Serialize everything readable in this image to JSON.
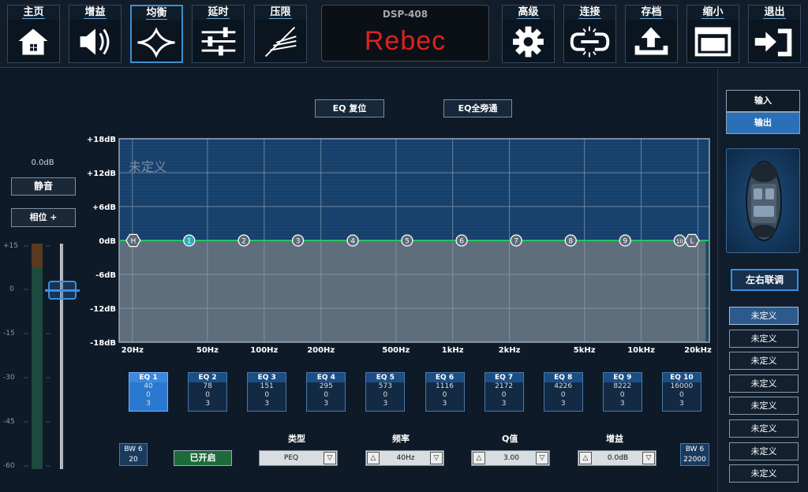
{
  "nav": {
    "left": [
      {
        "label": "主页",
        "icon": "home-icon"
      },
      {
        "label": "增益",
        "icon": "speaker-icon"
      },
      {
        "label": "均衡",
        "icon": "eq-star-icon"
      },
      {
        "label": "延时",
        "icon": "sliders-icon"
      },
      {
        "label": "压限",
        "icon": "limiter-icon"
      }
    ],
    "right": [
      {
        "label": "高级",
        "icon": "gear-icon"
      },
      {
        "label": "连接",
        "icon": "link-icon"
      },
      {
        "label": "存档",
        "icon": "upload-icon"
      },
      {
        "label": "缩小",
        "icon": "window-icon"
      },
      {
        "label": "退出",
        "icon": "exit-icon"
      }
    ],
    "active_index": 2
  },
  "logo": {
    "model": "DSP-408",
    "brand": "Rebec"
  },
  "eq_actions": {
    "reset": "EQ 复位",
    "bypass": "EQ全旁通"
  },
  "left_panel": {
    "level": "0.0dB",
    "mute": "静音",
    "phase": "相位 +",
    "scale": [
      "+15",
      "0",
      "-15",
      "-30",
      "-45",
      "-60"
    ],
    "fader_value_db": 0
  },
  "chart": {
    "watermark": "未定义",
    "y_labels": [
      "+18dB",
      "+12dB",
      "+6dB",
      "0dB",
      "-6dB",
      "-12dB",
      "-18dB"
    ],
    "x_labels": [
      "20Hz",
      "50Hz",
      "100Hz",
      "200Hz",
      "500Hz",
      "1kHz",
      "2kHz",
      "5kHz",
      "10kHz",
      "20kHz"
    ],
    "markers": [
      "H",
      "1",
      "2",
      "3",
      "4",
      "5",
      "6",
      "7",
      "8",
      "9",
      "10",
      "L"
    ]
  },
  "chart_data": {
    "type": "line",
    "ylim": [
      -18,
      18
    ],
    "xlim": [
      20,
      20000
    ],
    "x_scale": "log",
    "y_ticks": [
      18,
      12,
      6,
      0,
      -6,
      -12,
      -18
    ],
    "x_ticks": [
      20,
      50,
      100,
      200,
      500,
      1000,
      2000,
      5000,
      10000,
      20000
    ],
    "grid": true,
    "series": [
      {
        "x": [
          20,
          20000
        ],
        "y": [
          0,
          0
        ]
      }
    ],
    "markers": [
      {
        "label": "H",
        "x": 20,
        "y": 0
      },
      {
        "label": "1",
        "x": 40,
        "y": 0
      },
      {
        "label": "2",
        "x": 78,
        "y": 0
      },
      {
        "label": "3",
        "x": 151,
        "y": 0
      },
      {
        "label": "4",
        "x": 295,
        "y": 0
      },
      {
        "label": "5",
        "x": 573,
        "y": 0
      },
      {
        "label": "6",
        "x": 1116,
        "y": 0
      },
      {
        "label": "7",
        "x": 2172,
        "y": 0
      },
      {
        "label": "8",
        "x": 4226,
        "y": 0
      },
      {
        "label": "9",
        "x": 8222,
        "y": 0
      },
      {
        "label": "10",
        "x": 16000,
        "y": 0
      },
      {
        "label": "L",
        "x": 22000,
        "y": 0
      }
    ],
    "watermark": "未定义"
  },
  "eq_bands": [
    {
      "name": "EQ 1",
      "freq": "40",
      "gain": "0",
      "q": "3"
    },
    {
      "name": "EQ 2",
      "freq": "78",
      "gain": "0",
      "q": "3"
    },
    {
      "name": "EQ 3",
      "freq": "151",
      "gain": "0",
      "q": "3"
    },
    {
      "name": "EQ 4",
      "freq": "295",
      "gain": "0",
      "q": "3"
    },
    {
      "name": "EQ 5",
      "freq": "573",
      "gain": "0",
      "q": "3"
    },
    {
      "name": "EQ 6",
      "freq": "1116",
      "gain": "0",
      "q": "3"
    },
    {
      "name": "EQ 7",
      "freq": "2172",
      "gain": "0",
      "q": "3"
    },
    {
      "name": "EQ 8",
      "freq": "4226",
      "gain": "0",
      "q": "3"
    },
    {
      "name": "EQ 9",
      "freq": "8222",
      "gain": "0",
      "q": "3"
    },
    {
      "name": "EQ 10",
      "freq": "16000",
      "gain": "0",
      "q": "3"
    }
  ],
  "selected_band": 0,
  "controls": {
    "bw_left": {
      "label": "BW 6",
      "value": "20"
    },
    "bw_right": {
      "label": "BW 6",
      "value": "22000"
    },
    "enabled": "已开启",
    "type_label": "类型",
    "type_value": "PEQ",
    "freq_label": "频率",
    "freq_value": "40Hz",
    "q_label": "Q值",
    "q_value": "3.00",
    "gain_label": "增益",
    "gain_value": "0.0dB"
  },
  "right_panel": {
    "input": "输入",
    "output": "输出",
    "link": "左右联调",
    "slots": [
      "未定义",
      "未定义",
      "未定义",
      "未定义",
      "未定义",
      "未定义",
      "未定义",
      "未定义"
    ],
    "selected_slot": 0
  },
  "colors": {
    "accent": "#3f8fd0",
    "curve": "#22c55e",
    "enabled": "#1e6b3a",
    "logo": "#e02020"
  }
}
